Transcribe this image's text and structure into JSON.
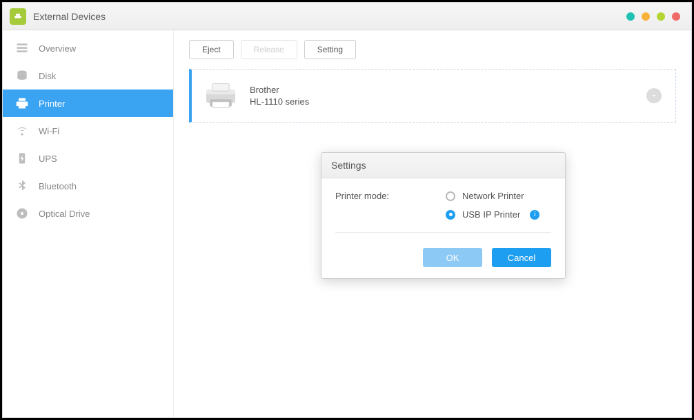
{
  "header": {
    "title": "External Devices"
  },
  "sidebar": {
    "items": [
      {
        "id": "overview",
        "label": "Overview",
        "icon": "overview-icon",
        "active": false
      },
      {
        "id": "disk",
        "label": "Disk",
        "icon": "disk-icon",
        "active": false
      },
      {
        "id": "printer",
        "label": "Printer",
        "icon": "printer-icon",
        "active": true
      },
      {
        "id": "wifi",
        "label": "Wi-Fi",
        "icon": "wifi-icon",
        "active": false
      },
      {
        "id": "ups",
        "label": "UPS",
        "icon": "ups-icon",
        "active": false
      },
      {
        "id": "bluetooth",
        "label": "Bluetooth",
        "icon": "bluetooth-icon",
        "active": false
      },
      {
        "id": "optical",
        "label": "Optical Drive",
        "icon": "optical-icon",
        "active": false
      }
    ]
  },
  "toolbar": {
    "eject_label": "Eject",
    "release_label": "Release",
    "setting_label": "Setting"
  },
  "device": {
    "brand": "Brother",
    "model": "HL-1110 series"
  },
  "dialog": {
    "title": "Settings",
    "mode_label": "Printer mode:",
    "options": {
      "network": "Network Printer",
      "usb_ip": "USB IP Printer"
    },
    "selected": "usb_ip",
    "ok_label": "OK",
    "cancel_label": "Cancel"
  }
}
